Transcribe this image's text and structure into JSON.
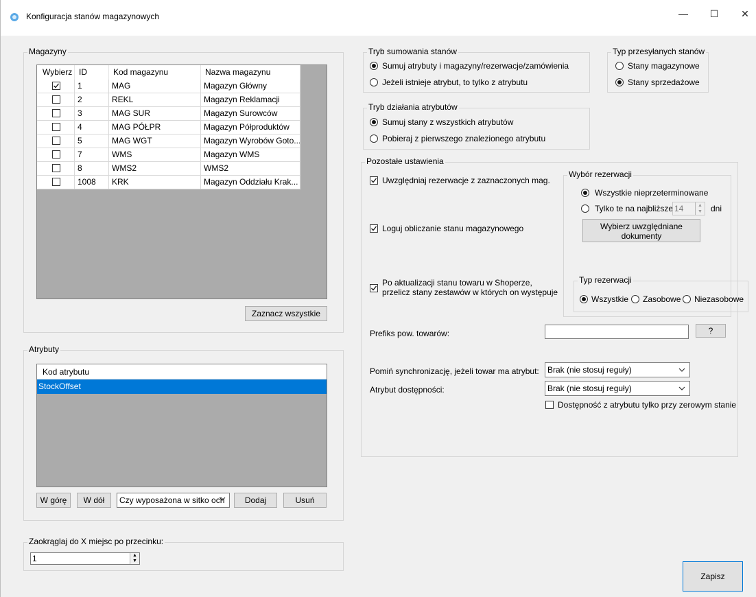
{
  "window": {
    "title": "Konfiguracja stanów magazynowych",
    "min": "—",
    "max": "☐",
    "close": "✕"
  },
  "magazyny": {
    "legend": "Magazyny",
    "columns": [
      "Wybierz",
      "ID",
      "Kod magazynu",
      "Nazwa magazynu"
    ],
    "rows": [
      {
        "checked": true,
        "id": "1",
        "kod": "MAG",
        "nazwa": "Magazyn Główny"
      },
      {
        "checked": false,
        "id": "2",
        "kod": "REKL",
        "nazwa": "Magazyn Reklamacji"
      },
      {
        "checked": false,
        "id": "3",
        "kod": "MAG SUR",
        "nazwa": "Magazyn Surowców"
      },
      {
        "checked": false,
        "id": "4",
        "kod": "MAG PÓŁPR",
        "nazwa": "Magazyn Półproduktów"
      },
      {
        "checked": false,
        "id": "5",
        "kod": "MAG WGT",
        "nazwa": "Magazyn Wyrobów Goto..."
      },
      {
        "checked": false,
        "id": "7",
        "kod": "WMS",
        "nazwa": "Magazyn WMS"
      },
      {
        "checked": false,
        "id": "8",
        "kod": "WMS2",
        "nazwa": "WMS2"
      },
      {
        "checked": false,
        "id": "1008",
        "kod": "KRK",
        "nazwa": "Magazyn Oddziału Krak..."
      }
    ],
    "select_all": "Zaznacz wszystkie"
  },
  "atrybuty": {
    "legend": "Atrybuty",
    "column": "Kod atrybutu",
    "rows": [
      "StockOffset"
    ],
    "up": "W górę",
    "down": "W dół",
    "combo_value": "Czy wyposażona w sitko och",
    "add": "Dodaj",
    "remove": "Usuń"
  },
  "zaokraglaj": {
    "legend": "Zaokrąglaj do X miejsc po przecinku:",
    "value": "1"
  },
  "tryb_sumowania": {
    "legend": "Tryb sumowania stanów",
    "options": [
      "Sumuj atrybuty i magazyny/rezerwacje/zamówienia",
      "Jeżeli istnieje atrybut, to tylko z atrybutu"
    ],
    "selected": 0
  },
  "typ_przesylanych": {
    "legend": "Typ przesyłanych stanów",
    "options": [
      "Stany magazynowe",
      "Stany sprzedażowe"
    ],
    "selected": 1
  },
  "tryb_dzialania": {
    "legend": "Tryb działania atrybutów",
    "options": [
      "Sumuj stany z wszystkich atrybutów",
      "Pobieraj z pierwszego znalezionego atrybutu"
    ],
    "selected": 0
  },
  "pozostale": {
    "legend": "Pozostałe ustawienia",
    "chk_rezerwacje": "Uwzględniaj rezerwacje z zaznaczonych mag.",
    "chk_loguj": "Loguj obliczanie stanu magazynowego",
    "chk_po_aktualizacji_1": "Po aktualizacji stanu towaru w Shoperze,",
    "chk_po_aktualizacji_2": "przelicz stany zestawów w których on występuje",
    "wybor_rezerwacji": {
      "legend": "Wybór rezerwacji",
      "opt_all": "Wszystkie nieprzeterminowane",
      "opt_next": "Tylko te na najbliższe",
      "days_value": "14",
      "days_label": "dni",
      "docs_btn_1": "Wybierz uwzględniane",
      "docs_btn_2": "dokumenty"
    },
    "typ_rezerwacji": {
      "legend": "Typ rezerwacji",
      "options": [
        "Wszystkie",
        "Zasobowe",
        "Niezasobowe"
      ],
      "selected": 0
    },
    "prefiks_label": "Prefiks pow. towarów:",
    "prefiks_value": "",
    "prefiks_btn": "?",
    "pomin_label": "Pomiń synchronizację, jeżeli towar ma atrybut:",
    "pomin_value": "Brak (nie stosuj reguły)",
    "dostepnosc_label": "Atrybut dostępności:",
    "dostepnosc_value": "Brak (nie stosuj reguły)",
    "chk_zerowy": "Dostępność z atrybutu tylko przy zerowym stanie"
  },
  "save": "Zapisz"
}
